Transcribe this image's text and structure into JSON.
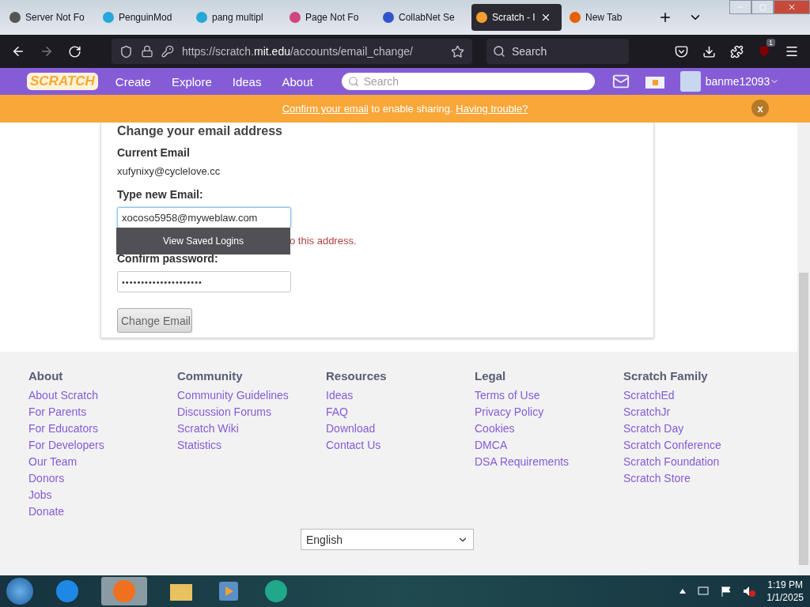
{
  "browser": {
    "tabs": [
      {
        "title": "Server Not Fo",
        "selected": false
      },
      {
        "title": "PenguinMod",
        "selected": false
      },
      {
        "title": "pang multipl",
        "selected": false
      },
      {
        "title": "Page Not Fo",
        "selected": false
      },
      {
        "title": "CollabNet Se",
        "selected": false
      },
      {
        "title": "Scratch - I",
        "selected": true
      },
      {
        "title": "New Tab",
        "selected": false
      }
    ],
    "url_prefix": "https://scratch.",
    "url_domain": "mit.edu",
    "url_path": "/accounts/email_change/",
    "search_placeholder": "Search",
    "extension_badge": "1"
  },
  "site_nav": {
    "logo": "SCRATCH",
    "links": [
      "Create",
      "Explore",
      "Ideas",
      "About"
    ],
    "search_placeholder": "Search",
    "username": "banme12093"
  },
  "banner": {
    "link": "Confirm your email",
    "text": " to enable sharing.",
    "help_link": "Having trouble?",
    "close": "x"
  },
  "form": {
    "heading": "Change your email address",
    "current_label": "Current Email",
    "current_value": "xufynixy@cyclelove.cc",
    "new_label": "Type new Email:",
    "new_value": "xocoso5958@myweblaw.com",
    "autofill_popup": "View Saved Logins",
    "error_text": "o this address.",
    "password_label": "Confirm password:",
    "password_value": "•••••••••••••••••••••",
    "submit": "Change Email"
  },
  "footer": {
    "columns": [
      {
        "title": "About",
        "links": [
          "About Scratch",
          "For Parents",
          "For Educators",
          "For Developers",
          "Our Team",
          "Donors",
          "Jobs",
          "Donate"
        ]
      },
      {
        "title": "Community",
        "links": [
          "Community Guidelines",
          "Discussion Forums",
          "Scratch Wiki",
          "Statistics"
        ]
      },
      {
        "title": "Resources",
        "links": [
          "Ideas",
          "FAQ",
          "Download",
          "Contact Us"
        ]
      },
      {
        "title": "Legal",
        "links": [
          "Terms of Use",
          "Privacy Policy",
          "Cookies",
          "DMCA",
          "DSA Requirements"
        ]
      },
      {
        "title": "Scratch Family",
        "links": [
          "ScratchEd",
          "ScratchJr",
          "Scratch Day",
          "Scratch Conference",
          "Scratch Foundation",
          "Scratch Store"
        ]
      }
    ],
    "language": "English"
  },
  "taskbar": {
    "time": "1:19 PM",
    "date": "1/1/2025"
  }
}
